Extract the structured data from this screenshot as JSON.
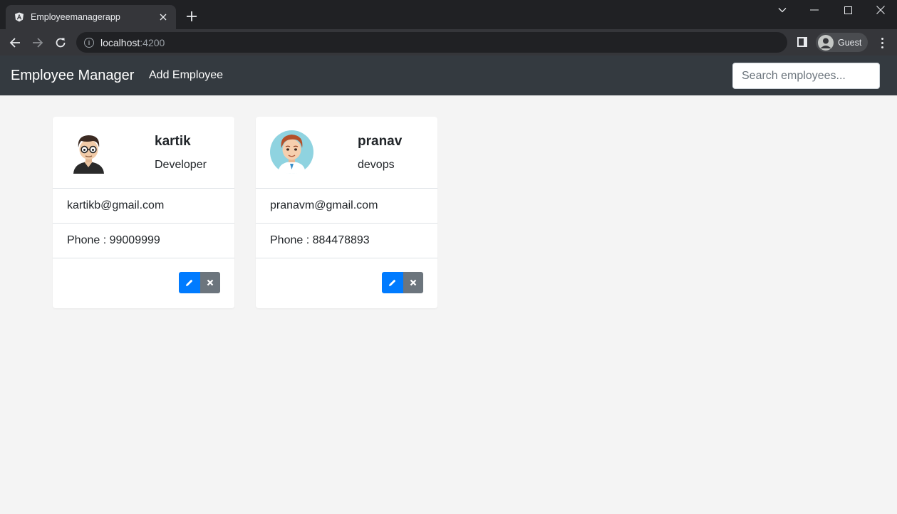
{
  "browser": {
    "tab_title": "Employeemanagerapp",
    "url_host": "localhost",
    "url_port": ":4200",
    "profile_label": "Guest"
  },
  "navbar": {
    "brand": "Employee Manager",
    "add_link": "Add Employee",
    "search_placeholder": "Search employees..."
  },
  "employees": [
    {
      "name": "kartik",
      "job_title": "Developer",
      "email": "kartikb@gmail.com",
      "phone": "Phone : 99009999",
      "avatar": "cartoon-man-glasses"
    },
    {
      "name": "pranav",
      "job_title": "devops",
      "email": "pranavm@gmail.com",
      "phone": "Phone : 884478893",
      "avatar": "cartoon-man-redhead"
    }
  ],
  "icons": {
    "edit": "pencil-icon",
    "delete": "close-icon"
  },
  "colors": {
    "navbar_bg": "#343a40",
    "page_bg": "#f4f4f4",
    "edit_button": "#007bff",
    "delete_button": "#6c757d"
  }
}
